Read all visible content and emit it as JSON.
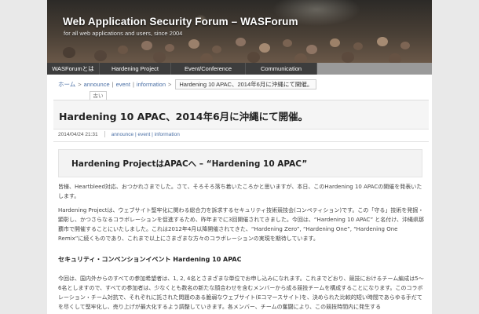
{
  "header": {
    "title": "Web Application Security Forum – WASForum",
    "tagline": "for all web applications and users, since 2004"
  },
  "nav": {
    "items": [
      {
        "label": "WASForumとは"
      },
      {
        "label": "Hardening Project"
      },
      {
        "label": "Event/Conference"
      },
      {
        "label": "Communication"
      }
    ]
  },
  "breadcrumb": {
    "home": "ホーム",
    "cat1": "announce",
    "cat2": "event",
    "cat3": "information",
    "current": "Hardening 10 APAC、2014年6月に沖縄にて開催。"
  },
  "post": {
    "tab_label": "古い",
    "title": "Hardening 10 APAC、2014年6月に沖縄にて開催。",
    "date": "2014/04/24 21:31",
    "categories": "announce | event | information",
    "subtitle": "Hardening ProjectはAPACへ – “Hardening 10 APAC”",
    "paragraphs": [
      "皆様、Heartbleed対応、おつかれさまでした。さて、そろそろ落ち着いたころかと思いますが、本日、このHardening 10 APACの開催を発表いたします。",
      "Hardening Projectは、ウェブサイト堅牢化に関わる総合力を訴求するセキュリティ技術競技会(コンペティション)です。この「守る」技術を発掘・顕彰し、かつさらなるコラボレーションを促進するため、昨年までに3回開催されてきました。今回は、“Hardening 10 APAC” と名付け、沖縄県那覇市で開催することにいたしました。これは2012年4月以降開催されてきた、“Hardening Zero”, “Hardening One”, “Hardening One Remix”に続くものであり、これまで以上にさまざまな方々のコラボレーションの実現を期待しています。",
      "今回は、国内外からのすべての参加希望者は、1, 2, 4名とさまざまな単位でお申し込みになれます。これまでどおり、競技におけるチーム編成は5〜6名としますので、すべての参加者は、少なくとも数名の新たな顔合わせを含むメンバーから成る競技チームを構成することになります。このコラボレーション・チーム対抗で、それぞれに託された問題のある脆弱なウェブサイト(Eコマースサイト)を、決められた比較的短い時間であらゆる手だてを尽くして堅牢化し、売り上げが最大化するよう調整していきます。各メンバー、チームの奮闘により、この競技時間内に発生する"
    ],
    "section_heading": "セキュリティ・コンベンションイベント Hardening 10 APAC"
  },
  "colors": {
    "nav_bg": "#3d3d3d",
    "link": "#4a6fa5",
    "page_bg": "#e9e9e9"
  }
}
